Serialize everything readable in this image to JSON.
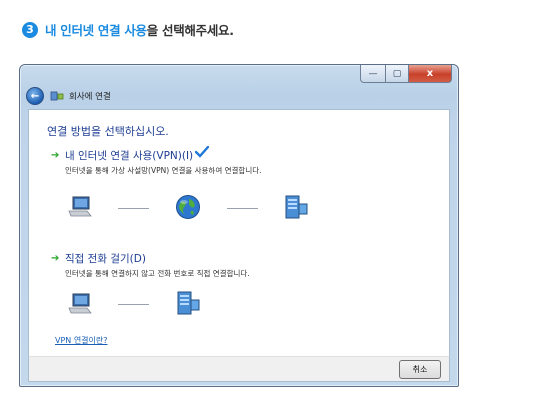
{
  "step": {
    "number": "3",
    "highlight": "내 인터넷 연결 사용",
    "rest": "을 선택해주세요."
  },
  "window": {
    "title": "회사에 연결",
    "buttons": {
      "minimize": "—",
      "maximize": "▢",
      "close": "x"
    },
    "heading": "연결 방법을 선택하십시오.",
    "options": [
      {
        "title": "내 인터넷 연결 사용(VPN)(I)",
        "description": "인터넷을 통해 가상 사설망(VPN) 연결을 사용하여 연결합니다.",
        "selected": true
      },
      {
        "title": "직접 전화 걸기(D)",
        "description": "인터넷을 통해 연결하지 않고 전화 번호로 직접 연결합니다.",
        "selected": false
      }
    ],
    "link": "VPN 연결이란?",
    "cancel_label": "취소"
  },
  "icons": {
    "back": "back-arrow-icon",
    "wizard": "network-wizard-icon",
    "option_arrow": "green-arrow-icon",
    "check": "checkmark-icon",
    "computer": "computer-icon",
    "internet": "globe-icon",
    "server": "server-icon"
  },
  "colors": {
    "accent_blue": "#1a8be0",
    "heading_blue": "#1d3d93",
    "arrow_green": "#29a52b",
    "check_blue": "#1f78d8",
    "close_red": "#c8402a"
  }
}
